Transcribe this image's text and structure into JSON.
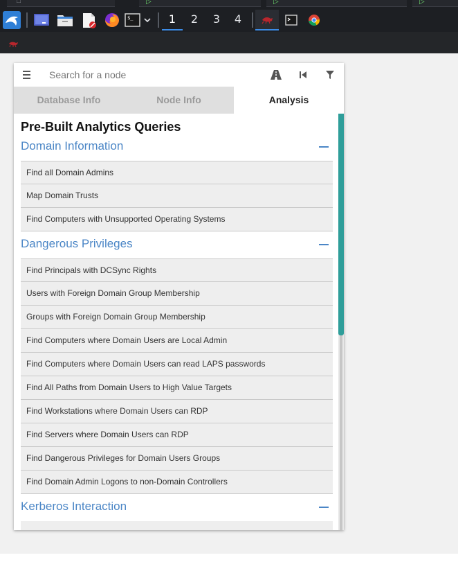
{
  "taskbar": {
    "workspaces": [
      "1",
      "2",
      "3",
      "4"
    ],
    "active_workspace": "1",
    "icons": {
      "launcher": "kali-dragon-icon",
      "desktop": "show-desktop-icon",
      "files": "file-manager-icon",
      "editor": "text-editor-icon",
      "browser": "firefox-icon",
      "terminal": "terminal-icon",
      "terminal_menu": "chevron-down-icon",
      "active_app": "bloodhound-icon",
      "terminal_window": "terminal-window-icon",
      "chrome": "chrome-icon"
    }
  },
  "subbar": {
    "icon": "bloodhound-icon"
  },
  "search": {
    "placeholder": "Search for a node"
  },
  "toolbar": {
    "menu_icon": "hamburger-menu-icon",
    "pathfinding_icon": "pathfinding-road-icon",
    "back_icon": "back-icon",
    "filter_icon": "filter-icon"
  },
  "tabs": [
    {
      "label": "Database Info"
    },
    {
      "label": "Node Info"
    },
    {
      "label": "Analysis"
    }
  ],
  "analysis": {
    "title": "Pre-Built Analytics Queries",
    "sections": [
      {
        "title": "Domain Information",
        "queries": [
          "Find all Domain Admins",
          "Map Domain Trusts",
          "Find Computers with Unsupported Operating Systems"
        ]
      },
      {
        "title": "Dangerous Privileges",
        "queries": [
          "Find Principals with DCSync Rights",
          "Users with Foreign Domain Group Membership",
          "Groups with Foreign Domain Group Membership",
          "Find Computers where Domain Users are Local Admin",
          "Find Computers where Domain Users can read LAPS passwords",
          "Find All Paths from Domain Users to High Value Targets",
          "Find Workstations where Domain Users can RDP",
          "Find Servers where Domain Users can RDP",
          "Find Dangerous Privileges for Domain Users Groups",
          "Find Domain Admin Logons to non-Domain Controllers"
        ]
      },
      {
        "title": "Kerberos Interaction",
        "queries": []
      }
    ]
  },
  "colors": {
    "section_accent": "#4b86c6",
    "scroll_thumb": "#2f9e9a",
    "taskbar_bg": "#1d1f23"
  }
}
